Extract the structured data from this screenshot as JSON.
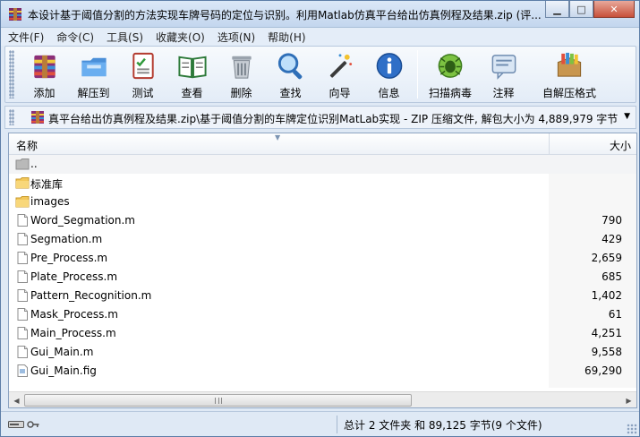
{
  "window": {
    "title": "本设计基于阈值分割的方法实现车牌号码的定位与识别。利用Matlab仿真平台给出仿真例程及结果.zip (评..."
  },
  "menu": [
    "文件(F)",
    "命令(C)",
    "工具(S)",
    "收藏夹(O)",
    "选项(N)",
    "帮助(H)"
  ],
  "toolbar": [
    {
      "label": "添加",
      "icon": "add-archive-icon"
    },
    {
      "label": "解压到",
      "icon": "extract-to-icon"
    },
    {
      "label": "测试",
      "icon": "test-icon"
    },
    {
      "label": "查看",
      "icon": "view-book-icon"
    },
    {
      "label": "删除",
      "icon": "delete-trash-icon"
    },
    {
      "label": "查找",
      "icon": "find-magnifier-icon"
    },
    {
      "label": "向导",
      "icon": "wizard-wand-icon"
    },
    {
      "label": "信息",
      "icon": "info-icon"
    },
    {
      "label": "扫描病毒",
      "icon": "virus-scan-icon"
    },
    {
      "label": "注释",
      "icon": "comment-icon"
    },
    {
      "label": "自解压格式",
      "icon": "sfx-box-icon"
    }
  ],
  "address": {
    "path": "真平台给出仿真例程及结果.zip\\基于阈值分割的车牌定位识别MatLab实现 - ZIP 压缩文件, 解包大小为 4,889,979 字节"
  },
  "columns": {
    "name": "名称",
    "size": "大小"
  },
  "files": [
    {
      "name": "..",
      "size": "",
      "type": "up"
    },
    {
      "name": "标准库",
      "size": "",
      "type": "folder"
    },
    {
      "name": "images",
      "size": "",
      "type": "folder"
    },
    {
      "name": "Word_Segmation.m",
      "size": "790",
      "type": "file"
    },
    {
      "name": "Segmation.m",
      "size": "429",
      "type": "file"
    },
    {
      "name": "Pre_Process.m",
      "size": "2,659",
      "type": "file"
    },
    {
      "name": "Plate_Process.m",
      "size": "685",
      "type": "file"
    },
    {
      "name": "Pattern_Recognition.m",
      "size": "1,402",
      "type": "file"
    },
    {
      "name": "Mask_Process.m",
      "size": "61",
      "type": "file"
    },
    {
      "name": "Main_Process.m",
      "size": "4,251",
      "type": "file"
    },
    {
      "name": "Gui_Main.m",
      "size": "9,558",
      "type": "file"
    },
    {
      "name": "Gui_Main.fig",
      "size": "69,290",
      "type": "fig"
    }
  ],
  "status": {
    "summary": "总计 2 文件夹 和 89,125 字节(9 个文件)"
  }
}
